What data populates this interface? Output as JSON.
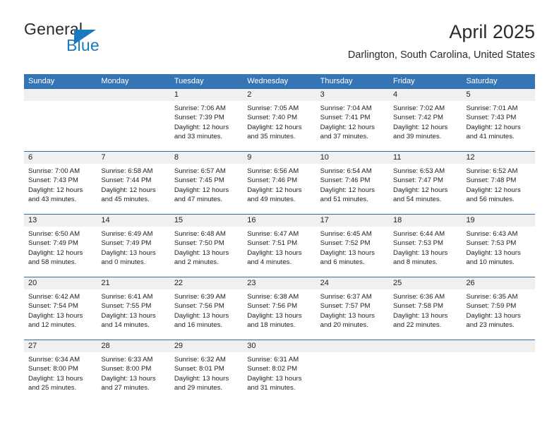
{
  "brand": {
    "name_top": "General",
    "name_bottom": "Blue",
    "color_blue": "#1b79c0",
    "color_dark": "#2b2b2b",
    "triangle_icon": "triangle-icon"
  },
  "header": {
    "title": "April 2025",
    "subtitle": "Darlington, South Carolina, United States"
  },
  "theme": {
    "header_blue": "#3575b5",
    "row_divider_blue": "#2f6fa8",
    "date_band_gray": "#f0f0f0"
  },
  "calendar": {
    "weekdays": [
      "Sunday",
      "Monday",
      "Tuesday",
      "Wednesday",
      "Thursday",
      "Friday",
      "Saturday"
    ],
    "weeks": [
      [
        {
          "day": "",
          "sunrise": "",
          "sunset": "",
          "daylight_line1": "",
          "daylight_line2": ""
        },
        {
          "day": "",
          "sunrise": "",
          "sunset": "",
          "daylight_line1": "",
          "daylight_line2": ""
        },
        {
          "day": "1",
          "sunrise": "Sunrise: 7:06 AM",
          "sunset": "Sunset: 7:39 PM",
          "daylight_line1": "Daylight: 12 hours",
          "daylight_line2": "and 33 minutes."
        },
        {
          "day": "2",
          "sunrise": "Sunrise: 7:05 AM",
          "sunset": "Sunset: 7:40 PM",
          "daylight_line1": "Daylight: 12 hours",
          "daylight_line2": "and 35 minutes."
        },
        {
          "day": "3",
          "sunrise": "Sunrise: 7:04 AM",
          "sunset": "Sunset: 7:41 PM",
          "daylight_line1": "Daylight: 12 hours",
          "daylight_line2": "and 37 minutes."
        },
        {
          "day": "4",
          "sunrise": "Sunrise: 7:02 AM",
          "sunset": "Sunset: 7:42 PM",
          "daylight_line1": "Daylight: 12 hours",
          "daylight_line2": "and 39 minutes."
        },
        {
          "day": "5",
          "sunrise": "Sunrise: 7:01 AM",
          "sunset": "Sunset: 7:43 PM",
          "daylight_line1": "Daylight: 12 hours",
          "daylight_line2": "and 41 minutes."
        }
      ],
      [
        {
          "day": "6",
          "sunrise": "Sunrise: 7:00 AM",
          "sunset": "Sunset: 7:43 PM",
          "daylight_line1": "Daylight: 12 hours",
          "daylight_line2": "and 43 minutes."
        },
        {
          "day": "7",
          "sunrise": "Sunrise: 6:58 AM",
          "sunset": "Sunset: 7:44 PM",
          "daylight_line1": "Daylight: 12 hours",
          "daylight_line2": "and 45 minutes."
        },
        {
          "day": "8",
          "sunrise": "Sunrise: 6:57 AM",
          "sunset": "Sunset: 7:45 PM",
          "daylight_line1": "Daylight: 12 hours",
          "daylight_line2": "and 47 minutes."
        },
        {
          "day": "9",
          "sunrise": "Sunrise: 6:56 AM",
          "sunset": "Sunset: 7:46 PM",
          "daylight_line1": "Daylight: 12 hours",
          "daylight_line2": "and 49 minutes."
        },
        {
          "day": "10",
          "sunrise": "Sunrise: 6:54 AM",
          "sunset": "Sunset: 7:46 PM",
          "daylight_line1": "Daylight: 12 hours",
          "daylight_line2": "and 51 minutes."
        },
        {
          "day": "11",
          "sunrise": "Sunrise: 6:53 AM",
          "sunset": "Sunset: 7:47 PM",
          "daylight_line1": "Daylight: 12 hours",
          "daylight_line2": "and 54 minutes."
        },
        {
          "day": "12",
          "sunrise": "Sunrise: 6:52 AM",
          "sunset": "Sunset: 7:48 PM",
          "daylight_line1": "Daylight: 12 hours",
          "daylight_line2": "and 56 minutes."
        }
      ],
      [
        {
          "day": "13",
          "sunrise": "Sunrise: 6:50 AM",
          "sunset": "Sunset: 7:49 PM",
          "daylight_line1": "Daylight: 12 hours",
          "daylight_line2": "and 58 minutes."
        },
        {
          "day": "14",
          "sunrise": "Sunrise: 6:49 AM",
          "sunset": "Sunset: 7:49 PM",
          "daylight_line1": "Daylight: 13 hours",
          "daylight_line2": "and 0 minutes."
        },
        {
          "day": "15",
          "sunrise": "Sunrise: 6:48 AM",
          "sunset": "Sunset: 7:50 PM",
          "daylight_line1": "Daylight: 13 hours",
          "daylight_line2": "and 2 minutes."
        },
        {
          "day": "16",
          "sunrise": "Sunrise: 6:47 AM",
          "sunset": "Sunset: 7:51 PM",
          "daylight_line1": "Daylight: 13 hours",
          "daylight_line2": "and 4 minutes."
        },
        {
          "day": "17",
          "sunrise": "Sunrise: 6:45 AM",
          "sunset": "Sunset: 7:52 PM",
          "daylight_line1": "Daylight: 13 hours",
          "daylight_line2": "and 6 minutes."
        },
        {
          "day": "18",
          "sunrise": "Sunrise: 6:44 AM",
          "sunset": "Sunset: 7:53 PM",
          "daylight_line1": "Daylight: 13 hours",
          "daylight_line2": "and 8 minutes."
        },
        {
          "day": "19",
          "sunrise": "Sunrise: 6:43 AM",
          "sunset": "Sunset: 7:53 PM",
          "daylight_line1": "Daylight: 13 hours",
          "daylight_line2": "and 10 minutes."
        }
      ],
      [
        {
          "day": "20",
          "sunrise": "Sunrise: 6:42 AM",
          "sunset": "Sunset: 7:54 PM",
          "daylight_line1": "Daylight: 13 hours",
          "daylight_line2": "and 12 minutes."
        },
        {
          "day": "21",
          "sunrise": "Sunrise: 6:41 AM",
          "sunset": "Sunset: 7:55 PM",
          "daylight_line1": "Daylight: 13 hours",
          "daylight_line2": "and 14 minutes."
        },
        {
          "day": "22",
          "sunrise": "Sunrise: 6:39 AM",
          "sunset": "Sunset: 7:56 PM",
          "daylight_line1": "Daylight: 13 hours",
          "daylight_line2": "and 16 minutes."
        },
        {
          "day": "23",
          "sunrise": "Sunrise: 6:38 AM",
          "sunset": "Sunset: 7:56 PM",
          "daylight_line1": "Daylight: 13 hours",
          "daylight_line2": "and 18 minutes."
        },
        {
          "day": "24",
          "sunrise": "Sunrise: 6:37 AM",
          "sunset": "Sunset: 7:57 PM",
          "daylight_line1": "Daylight: 13 hours",
          "daylight_line2": "and 20 minutes."
        },
        {
          "day": "25",
          "sunrise": "Sunrise: 6:36 AM",
          "sunset": "Sunset: 7:58 PM",
          "daylight_line1": "Daylight: 13 hours",
          "daylight_line2": "and 22 minutes."
        },
        {
          "day": "26",
          "sunrise": "Sunrise: 6:35 AM",
          "sunset": "Sunset: 7:59 PM",
          "daylight_line1": "Daylight: 13 hours",
          "daylight_line2": "and 23 minutes."
        }
      ],
      [
        {
          "day": "27",
          "sunrise": "Sunrise: 6:34 AM",
          "sunset": "Sunset: 8:00 PM",
          "daylight_line1": "Daylight: 13 hours",
          "daylight_line2": "and 25 minutes."
        },
        {
          "day": "28",
          "sunrise": "Sunrise: 6:33 AM",
          "sunset": "Sunset: 8:00 PM",
          "daylight_line1": "Daylight: 13 hours",
          "daylight_line2": "and 27 minutes."
        },
        {
          "day": "29",
          "sunrise": "Sunrise: 6:32 AM",
          "sunset": "Sunset: 8:01 PM",
          "daylight_line1": "Daylight: 13 hours",
          "daylight_line2": "and 29 minutes."
        },
        {
          "day": "30",
          "sunrise": "Sunrise: 6:31 AM",
          "sunset": "Sunset: 8:02 PM",
          "daylight_line1": "Daylight: 13 hours",
          "daylight_line2": "and 31 minutes."
        },
        {
          "day": "",
          "sunrise": "",
          "sunset": "",
          "daylight_line1": "",
          "daylight_line2": ""
        },
        {
          "day": "",
          "sunrise": "",
          "sunset": "",
          "daylight_line1": "",
          "daylight_line2": ""
        },
        {
          "day": "",
          "sunrise": "",
          "sunset": "",
          "daylight_line1": "",
          "daylight_line2": ""
        }
      ]
    ]
  }
}
